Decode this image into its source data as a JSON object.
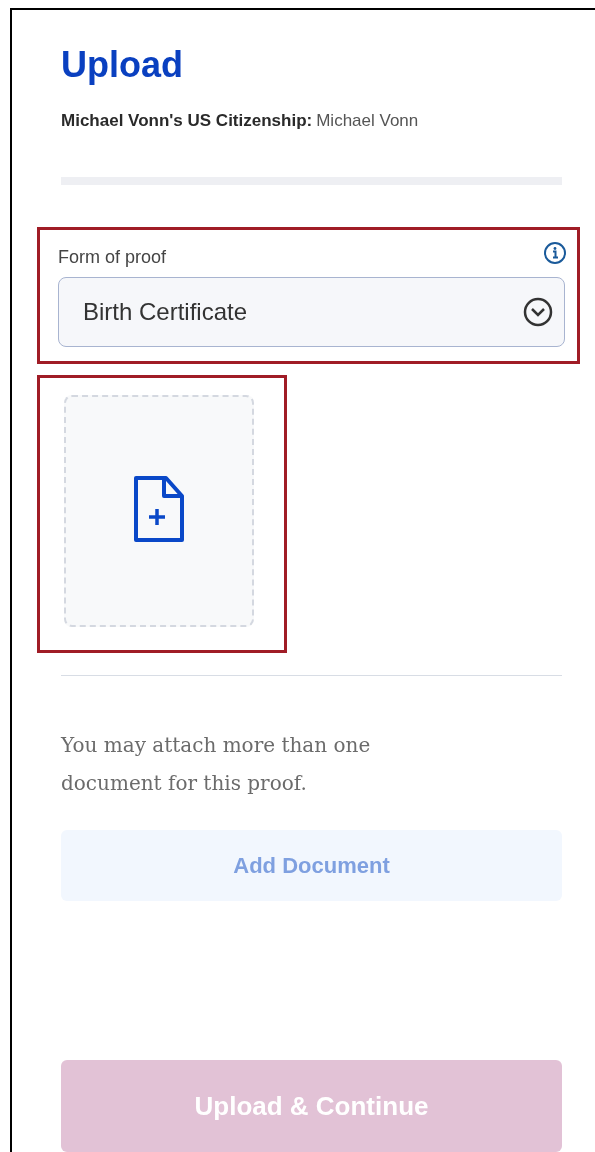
{
  "title": "Upload",
  "subtitle": {
    "label": "Michael Vonn's US Citizenship:",
    "value": "Michael Vonn"
  },
  "progress": {
    "level": 0
  },
  "proof_field": {
    "label": "Form of proof",
    "value": "Birth Certificate",
    "highlighted": true
  },
  "upload_tile": {
    "highlighted": true
  },
  "note": "You may attach more than one document for this proof.",
  "buttons": [
    {
      "label": "Add Document",
      "kind": "secondary",
      "disabled": true
    },
    {
      "label": "Upload & Continue",
      "kind": "primary",
      "disabled": true
    }
  ]
}
